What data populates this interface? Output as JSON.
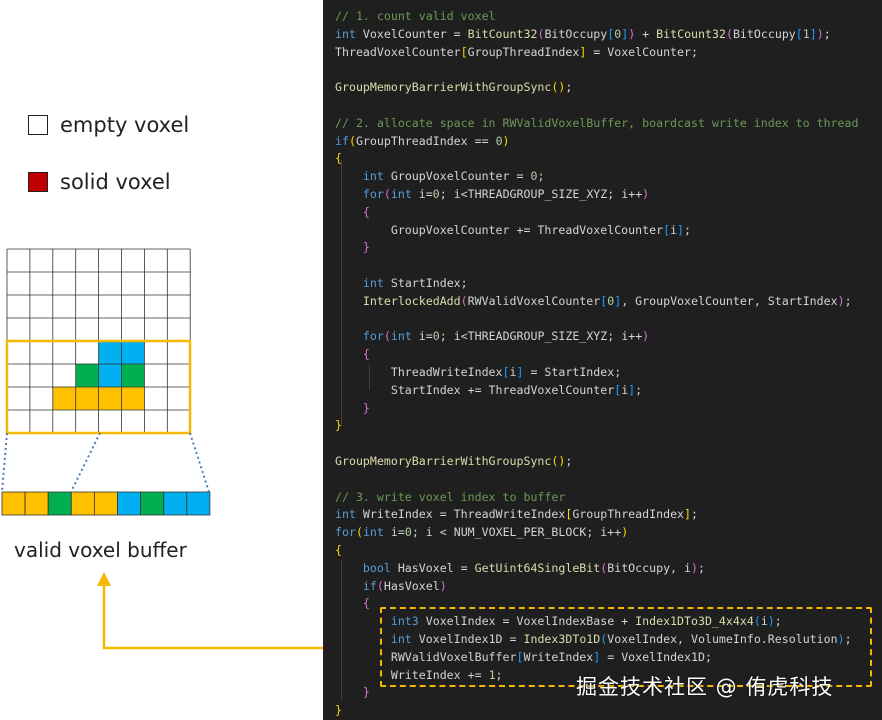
{
  "legend": {
    "empty_label": "empty voxel",
    "solid_label": "solid voxel",
    "solid_color": "#c00000"
  },
  "buffer_label": "valid voxel buffer",
  "colors": {
    "yellow": "#ffc000",
    "green": "#00b050",
    "blue": "#00b0f0",
    "outline": "#f5b800",
    "dotted": "#4a7bb7"
  },
  "grid": {
    "rows": 8,
    "cols": 8,
    "filled": [
      {
        "row": 4,
        "col": 4,
        "color": "blue"
      },
      {
        "row": 4,
        "col": 5,
        "color": "blue"
      },
      {
        "row": 5,
        "col": 3,
        "color": "green"
      },
      {
        "row": 5,
        "col": 4,
        "color": "blue"
      },
      {
        "row": 5,
        "col": 5,
        "color": "green"
      },
      {
        "row": 6,
        "col": 2,
        "color": "yellow"
      },
      {
        "row": 6,
        "col": 3,
        "color": "yellow"
      },
      {
        "row": 6,
        "col": 4,
        "color": "yellow"
      },
      {
        "row": 6,
        "col": 5,
        "color": "yellow"
      }
    ]
  },
  "buffer_cells": [
    "yellow",
    "yellow",
    "green",
    "yellow",
    "yellow",
    "blue",
    "green",
    "blue",
    "blue"
  ],
  "code_lines": [
    [
      [
        "c",
        "// 1. count valid voxel"
      ]
    ],
    [
      [
        "k",
        "int"
      ],
      [
        "t",
        " VoxelCounter = "
      ],
      [
        "f",
        "BitCount32"
      ],
      [
        "br2",
        "("
      ],
      [
        "t",
        "BitOccupy"
      ],
      [
        "br3",
        "["
      ],
      [
        "n",
        "0"
      ],
      [
        "br3",
        "]"
      ],
      [
        "br2",
        ")"
      ],
      [
        "t",
        " + "
      ],
      [
        "f",
        "BitCount32"
      ],
      [
        "br2",
        "("
      ],
      [
        "t",
        "BitOccupy"
      ],
      [
        "br3",
        "["
      ],
      [
        "n",
        "1"
      ],
      [
        "br3",
        "]"
      ],
      [
        "br2",
        ")"
      ],
      [
        "t",
        ";"
      ]
    ],
    [
      [
        "t",
        "ThreadVoxelCounter"
      ],
      [
        "br",
        "["
      ],
      [
        "t",
        "GroupThreadIndex"
      ],
      [
        "br",
        "]"
      ],
      [
        "t",
        " = VoxelCounter;"
      ]
    ],
    [],
    [
      [
        "f",
        "GroupMemoryBarrierWithGroupSync"
      ],
      [
        "br",
        "()"
      ],
      [
        "t",
        ";"
      ]
    ],
    [],
    [
      [
        "c",
        "// 2. allocate space in RWValidVoxelBuffer, boardcast write index to thread"
      ]
    ],
    [
      [
        "k",
        "if"
      ],
      [
        "br",
        "("
      ],
      [
        "t",
        "GroupThreadIndex == "
      ],
      [
        "n",
        "0"
      ],
      [
        "br",
        ")"
      ]
    ],
    [
      [
        "br",
        "{"
      ]
    ],
    [
      [
        "t",
        "    "
      ],
      [
        "k",
        "int"
      ],
      [
        "t",
        " GroupVoxelCounter = "
      ],
      [
        "n",
        "0"
      ],
      [
        "t",
        ";"
      ]
    ],
    [
      [
        "t",
        "    "
      ],
      [
        "k",
        "for"
      ],
      [
        "br2",
        "("
      ],
      [
        "k",
        "int"
      ],
      [
        "t",
        " i="
      ],
      [
        "n",
        "0"
      ],
      [
        "t",
        "; i<THREADGROUP_SIZE_XYZ; i++"
      ],
      [
        "br2",
        ")"
      ]
    ],
    [
      [
        "t",
        "    "
      ],
      [
        "br2",
        "{"
      ]
    ],
    [
      [
        "t",
        "        GroupVoxelCounter += ThreadVoxelCounter"
      ],
      [
        "br3",
        "["
      ],
      [
        "t",
        "i"
      ],
      [
        "br3",
        "]"
      ],
      [
        "t",
        ";"
      ]
    ],
    [
      [
        "t",
        "    "
      ],
      [
        "br2",
        "}"
      ]
    ],
    [],
    [
      [
        "t",
        "    "
      ],
      [
        "k",
        "int"
      ],
      [
        "t",
        " StartIndex;"
      ]
    ],
    [
      [
        "t",
        "    "
      ],
      [
        "f",
        "InterlockedAdd"
      ],
      [
        "br2",
        "("
      ],
      [
        "t",
        "RWValidVoxelCounter"
      ],
      [
        "br3",
        "["
      ],
      [
        "n",
        "0"
      ],
      [
        "br3",
        "]"
      ],
      [
        "t",
        ", GroupVoxelCounter, StartIndex"
      ],
      [
        "br2",
        ")"
      ],
      [
        "t",
        ";"
      ]
    ],
    [],
    [
      [
        "t",
        "    "
      ],
      [
        "k",
        "for"
      ],
      [
        "br2",
        "("
      ],
      [
        "k",
        "int"
      ],
      [
        "t",
        " i="
      ],
      [
        "n",
        "0"
      ],
      [
        "t",
        "; i<THREADGROUP_SIZE_XYZ; i++"
      ],
      [
        "br2",
        ")"
      ]
    ],
    [
      [
        "t",
        "    "
      ],
      [
        "br2",
        "{"
      ]
    ],
    [
      [
        "t",
        "        ThreadWriteIndex"
      ],
      [
        "br3",
        "["
      ],
      [
        "t",
        "i"
      ],
      [
        "br3",
        "]"
      ],
      [
        "t",
        " = StartIndex;"
      ]
    ],
    [
      [
        "t",
        "        StartIndex += ThreadVoxelCounter"
      ],
      [
        "br3",
        "["
      ],
      [
        "t",
        "i"
      ],
      [
        "br3",
        "]"
      ],
      [
        "t",
        ";"
      ]
    ],
    [
      [
        "t",
        "    "
      ],
      [
        "br2",
        "}"
      ]
    ],
    [
      [
        "br",
        "}"
      ]
    ],
    [],
    [
      [
        "f",
        "GroupMemoryBarrierWithGroupSync"
      ],
      [
        "br",
        "()"
      ],
      [
        "t",
        ";"
      ]
    ],
    [],
    [
      [
        "c",
        "// 3. write voxel index to buffer"
      ]
    ],
    [
      [
        "k",
        "int"
      ],
      [
        "t",
        " WriteIndex = ThreadWriteIndex"
      ],
      [
        "br",
        "["
      ],
      [
        "t",
        "GroupThreadIndex"
      ],
      [
        "br",
        "]"
      ],
      [
        "t",
        ";"
      ]
    ],
    [
      [
        "k",
        "for"
      ],
      [
        "br",
        "("
      ],
      [
        "k",
        "int"
      ],
      [
        "t",
        " i="
      ],
      [
        "n",
        "0"
      ],
      [
        "t",
        "; i < NUM_VOXEL_PER_BLOCK; i++"
      ],
      [
        "br",
        ")"
      ]
    ],
    [
      [
        "br",
        "{"
      ]
    ],
    [
      [
        "t",
        "    "
      ],
      [
        "k",
        "bool"
      ],
      [
        "t",
        " HasVoxel = "
      ],
      [
        "f",
        "GetUint64SingleBit"
      ],
      [
        "br2",
        "("
      ],
      [
        "t",
        "BitOccupy, i"
      ],
      [
        "br2",
        ")"
      ],
      [
        "t",
        ";"
      ]
    ],
    [
      [
        "t",
        "    "
      ],
      [
        "k",
        "if"
      ],
      [
        "br2",
        "("
      ],
      [
        "t",
        "HasVoxel"
      ],
      [
        "br2",
        ")"
      ]
    ],
    [
      [
        "t",
        "    "
      ],
      [
        "br2",
        "{"
      ]
    ],
    [
      [
        "t",
        "        "
      ],
      [
        "k",
        "int3"
      ],
      [
        "t",
        " VoxelIndex = VoxelIndexBase + "
      ],
      [
        "f",
        "Index1DTo3D_4x4x4"
      ],
      [
        "br3",
        "("
      ],
      [
        "t",
        "i"
      ],
      [
        "br3",
        ")"
      ],
      [
        "t",
        ";"
      ]
    ],
    [
      [
        "t",
        "        "
      ],
      [
        "k",
        "int"
      ],
      [
        "t",
        " VoxelIndex1D = "
      ],
      [
        "f",
        "Index3DTo1D"
      ],
      [
        "br3",
        "("
      ],
      [
        "t",
        "VoxelIndex, VolumeInfo.Resolution"
      ],
      [
        "br3",
        ")"
      ],
      [
        "t",
        ";"
      ]
    ],
    [
      [
        "t",
        "        RWValidVoxelBuffer"
      ],
      [
        "br3",
        "["
      ],
      [
        "t",
        "WriteIndex"
      ],
      [
        "br3",
        "]"
      ],
      [
        "t",
        " = VoxelIndex1D;"
      ]
    ],
    [
      [
        "t",
        "        WriteIndex += "
      ],
      [
        "n",
        "1"
      ],
      [
        "t",
        ";"
      ]
    ],
    [
      [
        "t",
        "    "
      ],
      [
        "br2",
        "}"
      ]
    ],
    [
      [
        "br",
        "}"
      ]
    ]
  ],
  "watermark": "掘金技术社区 @ 侑虎科技"
}
